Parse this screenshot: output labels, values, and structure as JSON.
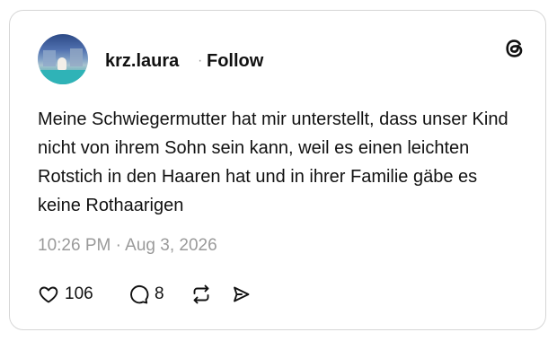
{
  "post": {
    "username": "krz.laura",
    "separator": "·",
    "follow_label": "Follow",
    "text": "Meine Schwiegermutter hat mir unterstellt, dass unser Kind nicht von ihrem Sohn sein kann, weil es einen leichten Rotstich in den Haaren hat und in ihrer Familie gäbe es keine Rothaarigen",
    "timestamp": "10:26 PM · Aug 3, 2026",
    "likes": "106",
    "replies": "8"
  },
  "icons": {
    "brand": "threads-logo-icon",
    "like": "heart-icon",
    "reply": "speech-bubble-icon",
    "repost": "repost-icon",
    "share": "send-icon"
  }
}
